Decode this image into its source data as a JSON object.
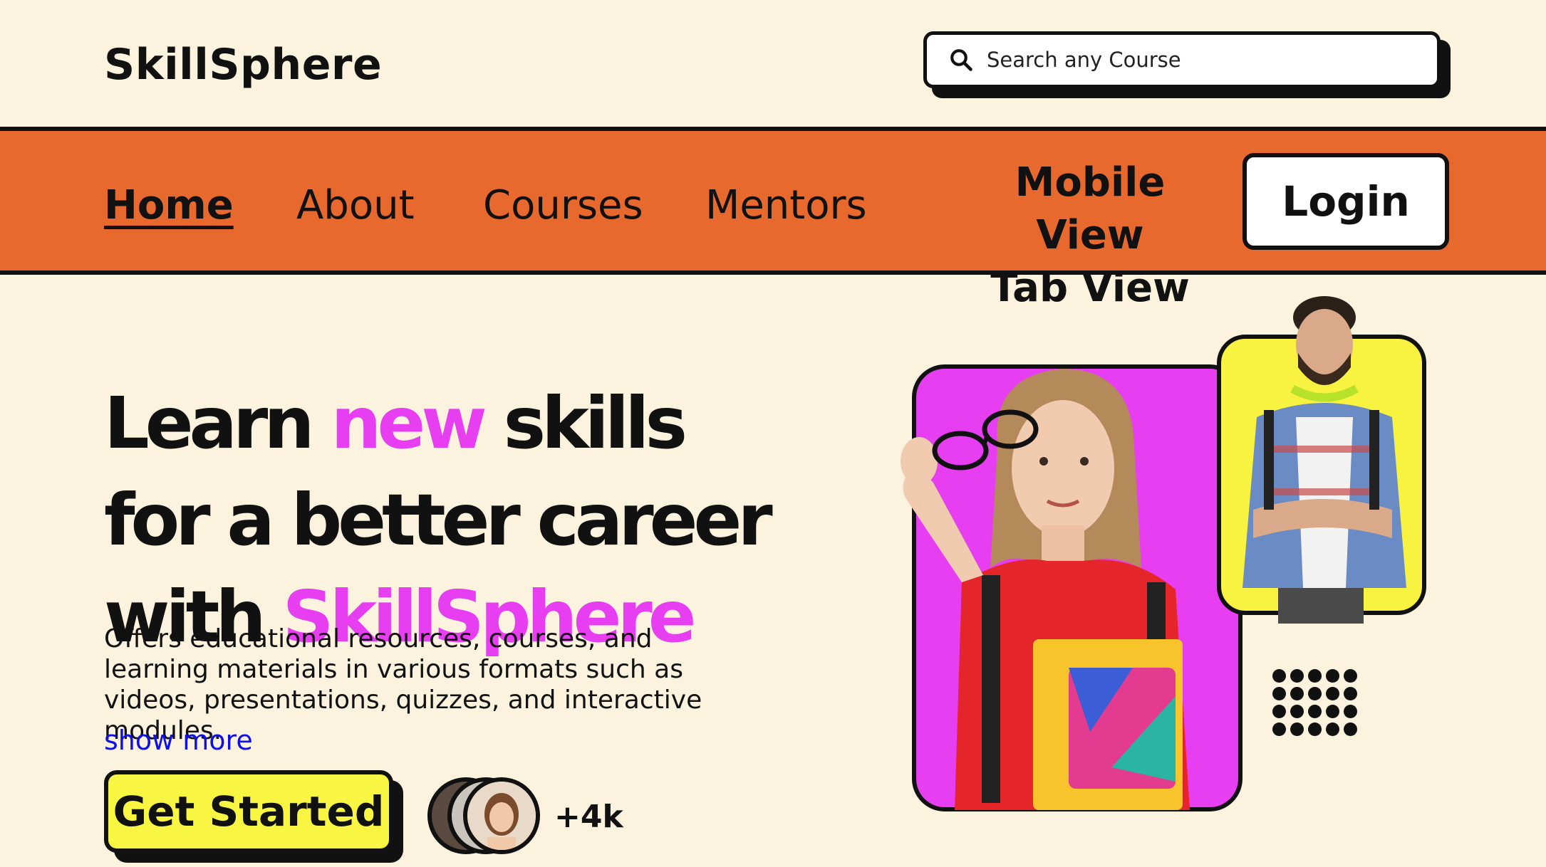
{
  "brand": {
    "name": "SkillSphere"
  },
  "search": {
    "placeholder": "Search any Course"
  },
  "nav": {
    "links": [
      "Home",
      "About",
      "Courses",
      "Mentors"
    ],
    "view_links": [
      "Mobile View",
      "Tab View"
    ],
    "login_label": "Login"
  },
  "hero": {
    "title_lines": [
      [
        {
          "text": "Learn "
        },
        {
          "text": "new",
          "accent": true
        },
        {
          "text": " skills"
        }
      ],
      [
        {
          "text": "for a better career"
        }
      ],
      [
        {
          "text": "with "
        },
        {
          "text": "SkillSphere",
          "accent": true
        }
      ]
    ],
    "description": "Offers educational resources, courses, and learning materials in various formats such as videos, presentations, quizzes, and interactive modules.",
    "show_more": "show more",
    "cta_label": "Get Started",
    "user_count": "+4k"
  },
  "colors": {
    "background": "#fcf3df",
    "nav_bar": "#e8692e",
    "accent_magenta": "#e63ef0",
    "accent_yellow": "#f8f543",
    "link_blue": "#1010e6"
  }
}
